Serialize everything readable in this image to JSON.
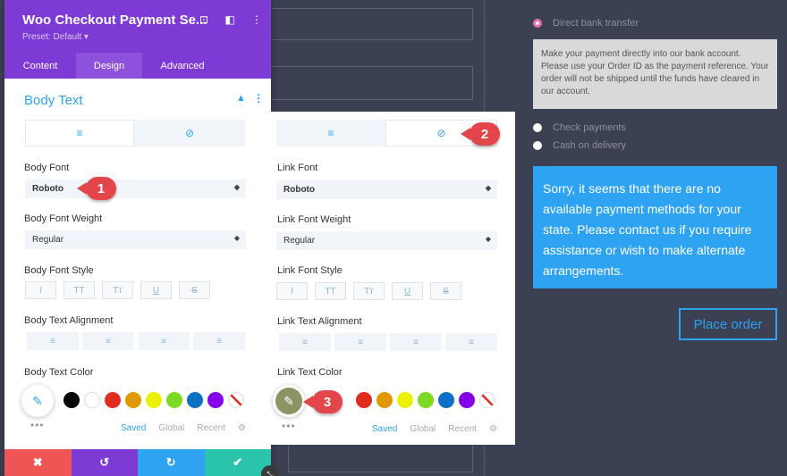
{
  "panel": {
    "title": "Woo Checkout Payment Se...",
    "preset": "Preset: Default ▾",
    "tabs": [
      "Content",
      "Design",
      "Advanced"
    ],
    "section": "Body Text",
    "icons": {
      "target": "⊡",
      "layout": "◧",
      "more": "⋮"
    }
  },
  "body": {
    "font_label": "Body Font",
    "font_value": "Roboto",
    "weight_label": "Body Font Weight",
    "weight_value": "Regular",
    "style_label": "Body Font Style",
    "align_label": "Body Text Alignment",
    "color_label": "Body Text Color"
  },
  "link": {
    "font_label": "Link Font",
    "font_value": "Roboto",
    "weight_label": "Link Font Weight",
    "weight_value": "Regular",
    "style_label": "Link Font Style",
    "align_label": "Link Text Alignment",
    "color_label": "Link Text Color"
  },
  "style_buttons": [
    "I",
    "TT",
    "Tт",
    "U",
    "S"
  ],
  "align_glyph": "≡",
  "swatch_colors": [
    "#000000",
    "#ffffff",
    "#e02b20",
    "#e09900",
    "#edf000",
    "#7cda24",
    "#0c71c3",
    "#8300e9"
  ],
  "swatch_tabs": [
    "Saved",
    "Global",
    "Recent"
  ],
  "footer_glyphs": [
    "✖",
    "↺",
    "↻",
    "✔"
  ],
  "footer_colors": [
    "#ef5555",
    "#7d3ad5",
    "#2ea3f2",
    "#29c4a9"
  ],
  "callouts": [
    "1",
    "2",
    "3"
  ],
  "payment": {
    "options": [
      "Direct bank transfer",
      "Check payments",
      "Cash on delivery"
    ],
    "description": "Make your payment directly into our bank account. Please use your Order ID as the payment reference. Your order will not be shipped until the funds have cleared in our account.",
    "notice": "Sorry, it seems that there are no available payment methods for your state. Please contact us if you require assistance or wish to make alternate arrangements.",
    "place_order": "Place order"
  }
}
